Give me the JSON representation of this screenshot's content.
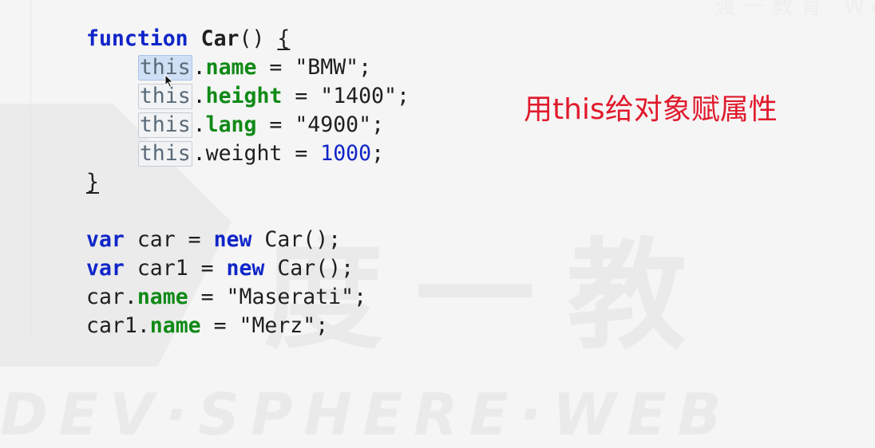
{
  "watermark": {
    "center_text": "度一教",
    "top_text": "渡一教育 Web",
    "bottom_text": "DEV·SPHERE·WEB"
  },
  "annotation": "用this给对象赋属性",
  "code": {
    "kw_function": "function",
    "fn_name": "Car",
    "fn_parens": "() ",
    "open_brace": "{",
    "close_brace": "}",
    "this_kw": "this",
    "assign_lines": [
      {
        "prop": "name",
        "op": " = ",
        "value": "\"BMW\"",
        "end": ";"
      },
      {
        "prop": "height",
        "op": " = ",
        "value": "\"1400\"",
        "end": ";"
      },
      {
        "prop": "lang",
        "op": " = ",
        "value": "\"4900\"",
        "end": ";"
      },
      {
        "prop": "weight",
        "op": " = ",
        "value": "1000",
        "end": ";"
      }
    ],
    "var_kw": "var",
    "new_kw": "new",
    "decl1_name": " car = ",
    "decl2_name": " car1 = ",
    "ctor_call": " Car();",
    "assign1": {
      "obj": "car.",
      "prop": "name",
      "op": " = ",
      "value": "\"Maserati\"",
      "end": ";"
    },
    "assign2": {
      "obj": "car1.",
      "prop": "name",
      "op": " = ",
      "value": "\"Merz\"",
      "end": ";"
    }
  }
}
